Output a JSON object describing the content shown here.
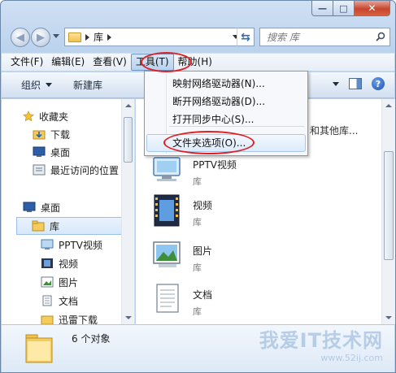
{
  "window": {
    "caption": {
      "minimize": "—",
      "maximize": "□",
      "close": "✕"
    }
  },
  "address": {
    "breadcrumb": "库",
    "search_placeholder": "搜索 库"
  },
  "menubar": {
    "items": [
      {
        "label": "文件(F)"
      },
      {
        "label": "编辑(E)"
      },
      {
        "label": "查看(V)"
      },
      {
        "label": "工具(T)",
        "active": true
      },
      {
        "label": "帮助(H)"
      }
    ]
  },
  "toolbar": {
    "organize": "组织",
    "new_library": "新建库",
    "help": "?"
  },
  "nav": {
    "favorites": "收藏夹",
    "downloads": "下载",
    "desktop_fav": "桌面",
    "recent": "最近访问的位置",
    "desktop": "桌面",
    "library": "库",
    "pptv": "PPTV视频",
    "videos": "视频",
    "pictures": "图片",
    "documents": "文档",
    "thunder": "迅雷下载"
  },
  "content": {
    "header_fragment": "和其他库...",
    "items": [
      {
        "name": "PPTV视频",
        "type": "库"
      },
      {
        "name": "视频",
        "type": "库"
      },
      {
        "name": "图片",
        "type": "库"
      },
      {
        "name": "文档",
        "type": "库"
      }
    ]
  },
  "tools_menu": {
    "map_drive": "映射网络驱动器(N)...",
    "disconnect_drive": "断开网络驱动器(D)...",
    "sync_center": "打开同步中心(S)...",
    "folder_options": "文件夹选项(O)..."
  },
  "status": {
    "count": "6 个对象"
  },
  "watermark": {
    "main": "我爱IT技术网",
    "sub": "www.52ij.com"
  },
  "colors": {
    "annotation": "#e02020",
    "accent": "#2f6cb3"
  }
}
